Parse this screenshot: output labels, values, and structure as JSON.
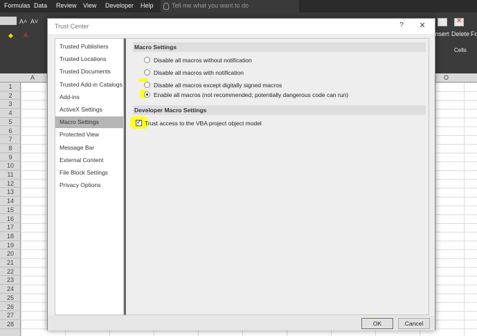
{
  "excel": {
    "menu": [
      "Formulas",
      "Data",
      "Review",
      "View",
      "Developer",
      "Help"
    ],
    "tell_me": "Tell me what you want to do",
    "ribbon_right": {
      "insert": "Insert",
      "delete": "Delete",
      "format_cut": "For",
      "cells": "Cells"
    },
    "columns": [
      "A",
      "O"
    ],
    "rows": [
      "1",
      "2",
      "3",
      "4",
      "5",
      "6",
      "7",
      "8",
      "9",
      "10",
      "11",
      "12",
      "13",
      "14",
      "15",
      "16",
      "17",
      "18",
      "19",
      "20",
      "21",
      "22",
      "23",
      "24",
      "25",
      "26",
      "27",
      "28"
    ]
  },
  "dialog": {
    "title": "Trust Center",
    "help_glyph": "?",
    "close_glyph": "✕",
    "nav": [
      {
        "label": "Trusted Publishers",
        "selected": false
      },
      {
        "label": "Trusted Locations",
        "selected": false
      },
      {
        "label": "Trusted Documents",
        "selected": false
      },
      {
        "label": "Trusted Add-in Catalogs",
        "selected": false
      },
      {
        "label": "Add-ins",
        "selected": false
      },
      {
        "label": "ActiveX Settings",
        "selected": false
      },
      {
        "label": "Macro Settings",
        "selected": true
      },
      {
        "label": "Protected View",
        "selected": false
      },
      {
        "label": "Message Bar",
        "selected": false
      },
      {
        "label": "External Content",
        "selected": false
      },
      {
        "label": "File Block Settings",
        "selected": false
      },
      {
        "label": "Privacy Options",
        "selected": false
      }
    ],
    "macro_settings": {
      "heading": "Macro Settings",
      "options": [
        {
          "label": "Disable all macros without notification",
          "selected": false
        },
        {
          "label": "Disable all macros with notification",
          "selected": false
        },
        {
          "label": "Disable all macros except digitally signed macros",
          "selected": false
        },
        {
          "label": "Enable all macros (not recommended; potentially dangerous code can run)",
          "selected": true
        }
      ]
    },
    "developer_settings": {
      "heading": "Developer Macro Settings",
      "trust_vba_label": "Trust access to the VBA project object model",
      "trust_vba_checked": true
    },
    "buttons": {
      "ok": "OK",
      "cancel": "Cancel"
    },
    "highlight_color": "#ffff00"
  }
}
